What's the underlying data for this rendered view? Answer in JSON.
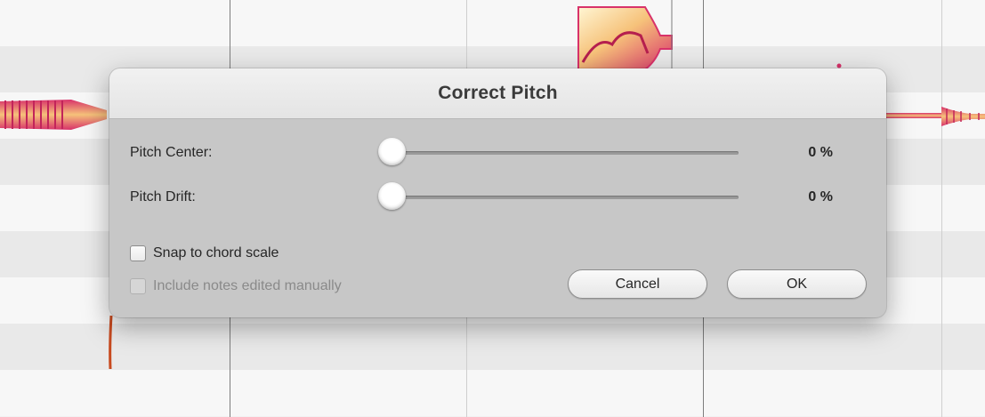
{
  "dialog": {
    "title": "Correct Pitch",
    "pitch_center": {
      "label": "Pitch Center:",
      "value_text": "0 %",
      "value": 0
    },
    "pitch_drift": {
      "label": "Pitch Drift:",
      "value_text": "0 %",
      "value": 0
    },
    "snap_to_chord_scale": {
      "label": "Snap to chord scale",
      "checked": false
    },
    "include_notes_edited_manually": {
      "label": "Include notes edited manually",
      "checked": false,
      "enabled": false
    },
    "cancel_label": "Cancel",
    "ok_label": "OK"
  },
  "colors": {
    "blob_outer": "#d8326a",
    "blob_inner": "#f6c27a",
    "blob_core": "#fff6d4"
  }
}
